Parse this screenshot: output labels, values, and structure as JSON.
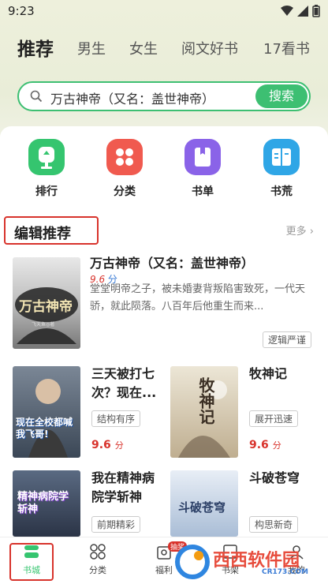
{
  "status": {
    "time": "9:23"
  },
  "tabs": [
    {
      "label": "推荐",
      "active": true
    },
    {
      "label": "男生"
    },
    {
      "label": "女生"
    },
    {
      "label": "阅文好书"
    },
    {
      "label": "17看书"
    }
  ],
  "search": {
    "value": "万古神帝（又名：盖世神帝）",
    "button": "搜索"
  },
  "quick": [
    {
      "label": "排行",
      "icon": "trophy-icon",
      "color": "#35c56f"
    },
    {
      "label": "分类",
      "icon": "grid-icon",
      "color": "#f05a4f"
    },
    {
      "label": "书单",
      "icon": "book-icon",
      "color": "#8a63e8"
    },
    {
      "label": "书荒",
      "icon": "reader-icon",
      "color": "#2fa6e6"
    }
  ],
  "section": {
    "title": "编辑推荐",
    "more": "更多"
  },
  "featured": {
    "title": "万古神帝（又名：盖世神帝）",
    "score": "9.6",
    "score_unit": "分",
    "desc": "堂堂明帝之子，被未婚妻背叛陷害致死，一代天骄，就此陨落。八百年后他重生而来...",
    "tag": "逻辑严谨",
    "cover_title": "万古神帝",
    "cover_author": "飞天鱼◎著"
  },
  "grid": [
    {
      "title": "三天被打七次？现在...",
      "tag": "结构有序",
      "score": "9.6",
      "unit": "分",
      "cover": "现在全校都喊我飞哥!"
    },
    {
      "title": "牧神记",
      "tag": "展开迅速",
      "score": "9.6",
      "unit": "分",
      "cover": "牧神记"
    },
    {
      "title": "我在精神病院学斩神",
      "tag": "前期精彩",
      "cover": "精神病院学斩神"
    },
    {
      "title": "斗破苍穹",
      "tag": "构思新奇",
      "cover": "斗破苍穹"
    }
  ],
  "nav": [
    {
      "label": "书城",
      "active": true
    },
    {
      "label": "分类"
    },
    {
      "label": "福利",
      "badge": "抽奖"
    },
    {
      "label": "书架"
    },
    {
      "label": "我的"
    }
  ],
  "watermark": {
    "text": "西西软件园",
    "site": "CR173.COM"
  }
}
